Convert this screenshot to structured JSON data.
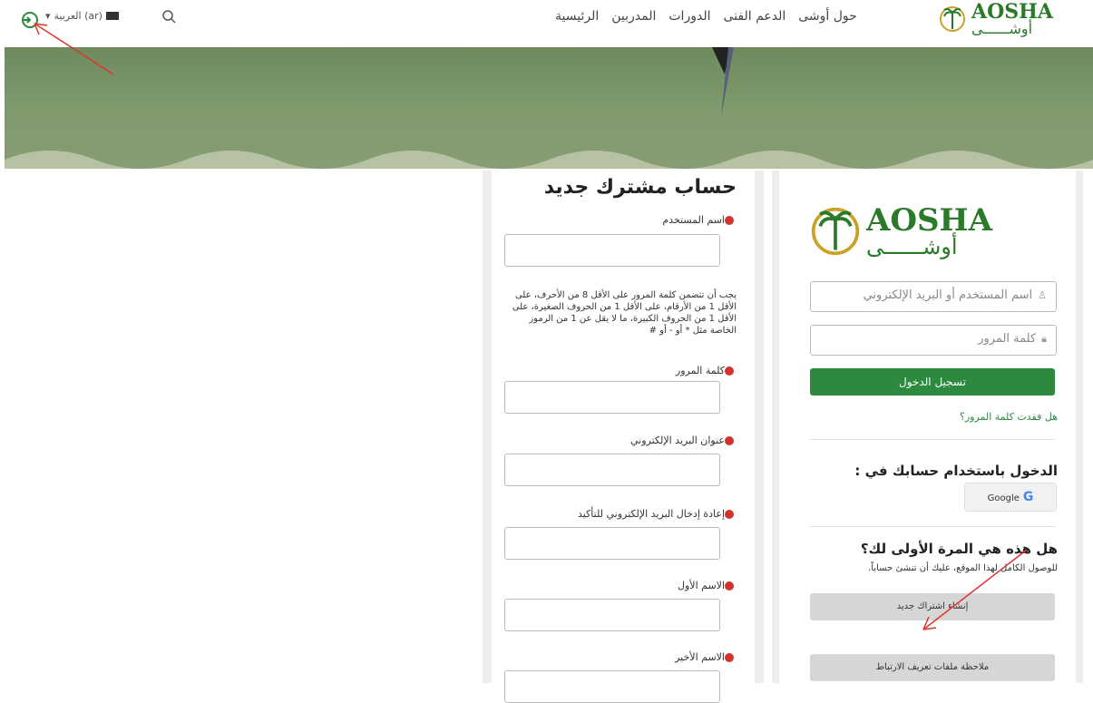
{
  "header": {
    "logo_en": "AOSHA",
    "logo_ar": "أوشــــــى",
    "nav": [
      "الرئيسية",
      "المدربين",
      "الدورات",
      "الدعم الفنى",
      "حول أوشى"
    ],
    "lang_label": "العربية (ar)",
    "lang_code": "AR"
  },
  "signup": {
    "title": "حساب مشترك جديد",
    "username_label": "اسم المستخدم",
    "password_policy": "يجب أن تتضمن كلمة المرور على الأقل 8 من الأحرف، على الأقل 1 من الأرقام، على الأقل 1 من الحروف الصغيرة، على الأقل 1 من الحروف الكبيرة، ما لا يقل عن 1 من الرموز الخاصة مثل * أو - أو #",
    "password_label": "كلمة المرور",
    "email_label": "عنوان البريد الإلكتروني",
    "email_confirm_label": "إعادة إدخال البريد الإلكتروني للتأكيد",
    "firstname_label": "الاسم الأول",
    "lastname_label": "الاسم الأخير"
  },
  "login": {
    "logo_en": "AOSHA",
    "logo_ar": "أوشــــــى",
    "username_placeholder": "اسم المستخدم أو البريد الإلكتروني",
    "password_placeholder": "كلمة المرور",
    "login_button": "تسجيل الدخول",
    "forgot_link": "هل فقدت كلمة المرور؟",
    "login_with": "الدخول باستخدام حسابك في :",
    "google_label": "Google",
    "first_time": "هل هذه هي المرة الأولى لك؟",
    "first_time_sub": "للوصول الكامل لهذا الموقع، عليك أن تنشئ حساباً.",
    "create_account_button": "إنشاء اشتراك جديد",
    "cookies_button": "ملاحظة ملفات تعريف الارتباط"
  },
  "colors": {
    "accent_green": "#2b8a3e",
    "required_red": "#d0342c",
    "annotation_red": "#e0342c"
  }
}
